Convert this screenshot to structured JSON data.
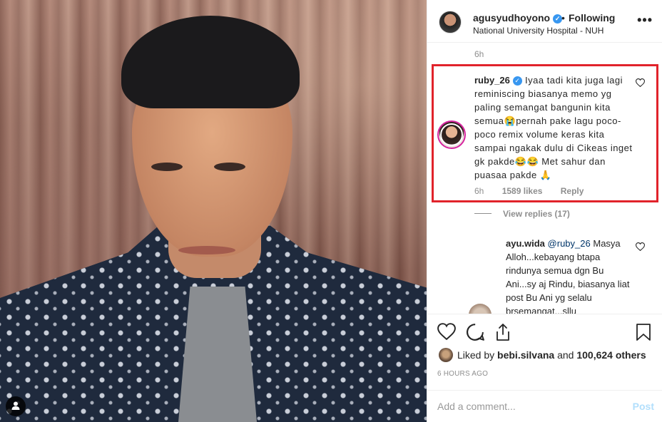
{
  "photo": {
    "tag_icon": "user-tag-icon"
  },
  "header": {
    "username": "agusyudhoyono",
    "separator": "•",
    "follow_status": "Following",
    "location": "National University Hospital - NUH",
    "more_icon": "more-options-icon"
  },
  "caption": {
    "time": "6h"
  },
  "highlighted_comment": {
    "author": "ruby_26",
    "text": "Iyaa tadi kita juga lagi reminiscing biasanya memo yg paling semangat bangunin kita semua😭pernah pake lagu poco-poco remix volume keras kita sampai ngakak dulu di Cikeas inget gk pakde😂😂 Met sahur dan puasaa pakde 🙏",
    "time": "6h",
    "likes": "1589 likes",
    "reply_label": "Reply",
    "highlight_color": "#e1232b"
  },
  "view_replies": "View replies (17)",
  "reply": {
    "author": "ayu.wida",
    "mention": "@ruby_26",
    "text": "Masya Alloh...kebayang btapa rindunya semua dgn Bu Ani...sy aj Rindu, biasanya liat post Bu Ani yg selalu brsemangat...sllu"
  },
  "actions": {
    "like_icon": "heart-icon",
    "comment_icon": "comment-icon",
    "share_icon": "share-icon",
    "save_icon": "bookmark-icon"
  },
  "likes_summary": {
    "prefix": "Liked by",
    "user": "bebi.silvana",
    "middle": "and",
    "others": "100,624 others"
  },
  "posted_time": "6 HOURS AGO",
  "comment_input": {
    "placeholder": "Add a comment...",
    "post_label": "Post",
    "post_color": "#b2dffc"
  }
}
